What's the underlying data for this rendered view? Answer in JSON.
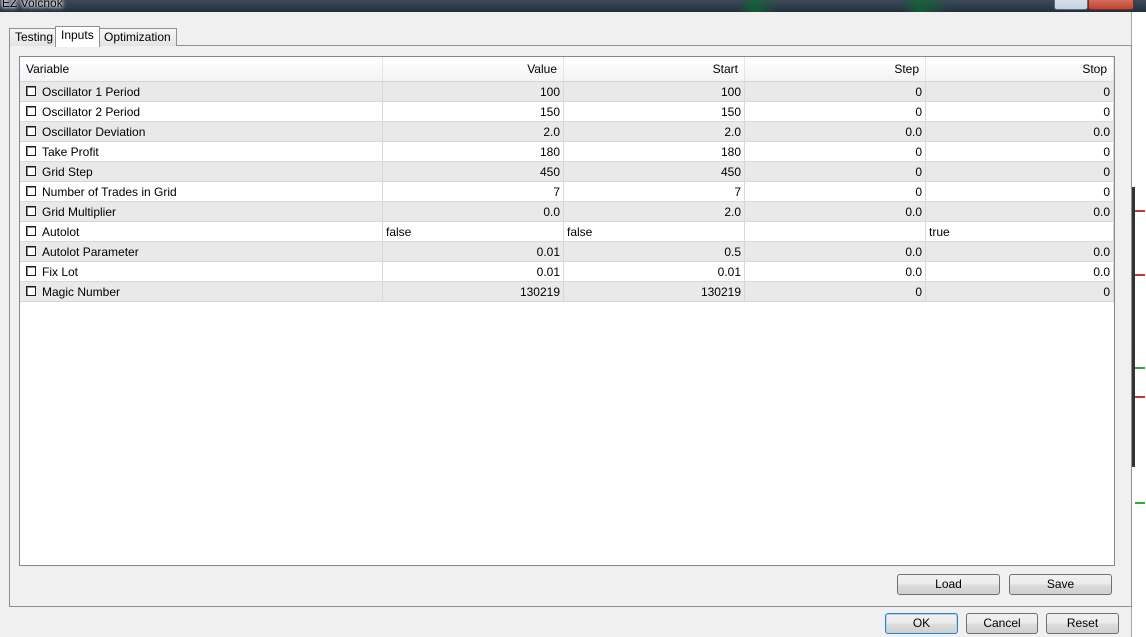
{
  "window": {
    "title": "EZ Volchok"
  },
  "tabs": [
    {
      "label": "Testing"
    },
    {
      "label": "Inputs"
    },
    {
      "label": "Optimization"
    }
  ],
  "grid": {
    "columns": [
      "Variable",
      "Value",
      "Start",
      "Step",
      "Stop"
    ],
    "rows": [
      {
        "variable": "Oscillator 1 Period",
        "value": "100",
        "start": "100",
        "step": "0",
        "stop": "0",
        "checked": false
      },
      {
        "variable": "Oscillator 2 Period",
        "value": "150",
        "start": "150",
        "step": "0",
        "stop": "0",
        "checked": false
      },
      {
        "variable": "Oscillator Deviation",
        "value": "2.0",
        "start": "2.0",
        "step": "0.0",
        "stop": "0.0",
        "checked": false
      },
      {
        "variable": "Take Profit",
        "value": "180",
        "start": "180",
        "step": "0",
        "stop": "0",
        "checked": false
      },
      {
        "variable": "Grid Step",
        "value": "450",
        "start": "450",
        "step": "0",
        "stop": "0",
        "checked": false
      },
      {
        "variable": "Number of Trades in Grid",
        "value": "7",
        "start": "7",
        "step": "0",
        "stop": "0",
        "checked": false
      },
      {
        "variable": "Grid Multiplier",
        "value": "0.0",
        "start": "2.0",
        "step": "0.0",
        "stop": "0.0",
        "checked": false
      },
      {
        "variable": "Autolot",
        "value": "false",
        "start": "false",
        "step": "",
        "stop": "true",
        "checked": false
      },
      {
        "variable": "Autolot Parameter",
        "value": "0.01",
        "start": "0.5",
        "step": "0.0",
        "stop": "0.0",
        "checked": false
      },
      {
        "variable": "Fix Lot",
        "value": "0.01",
        "start": "0.01",
        "step": "0.0",
        "stop": "0.0",
        "checked": false
      },
      {
        "variable": "Magic Number",
        "value": "130219",
        "start": "130219",
        "step": "0",
        "stop": "0",
        "checked": false
      }
    ]
  },
  "buttons": {
    "load": "Load",
    "save": "Save",
    "ok": "OK",
    "cancel": "Cancel",
    "reset": "Reset"
  }
}
